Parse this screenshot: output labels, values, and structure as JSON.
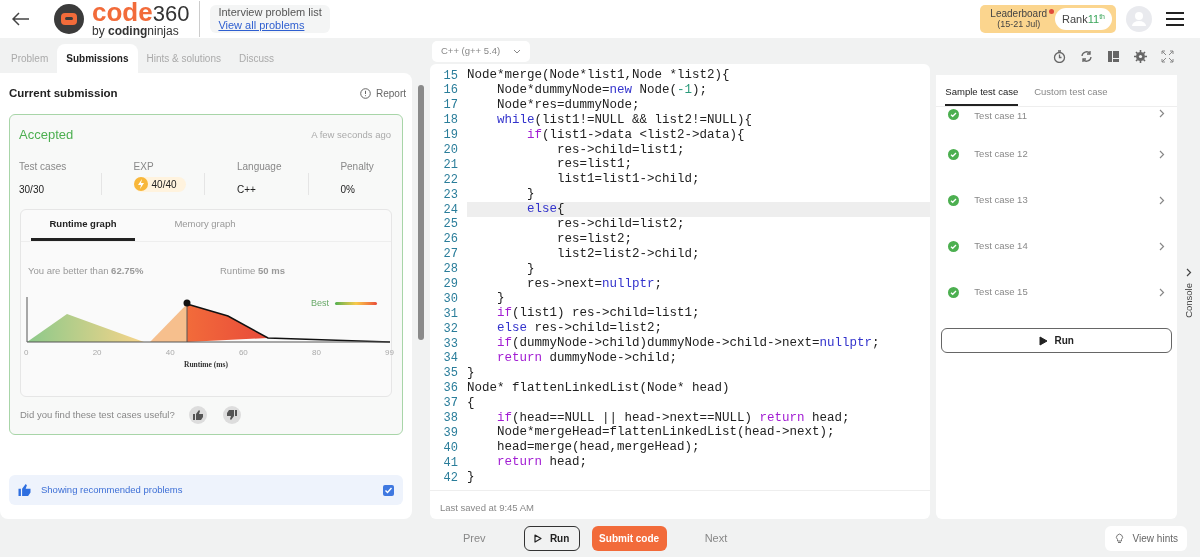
{
  "header": {
    "logo": {
      "word": "code",
      "number": "360",
      "tagline": "by **coding**ninjas"
    },
    "problem_list": {
      "title": "Interview problem list",
      "link": "View all problems"
    },
    "leaderboard": {
      "label": "Leaderboard",
      "dates": "(15-21 Jul)",
      "unread": true,
      "rank_label": "Rank",
      "rank": "11",
      "rank_suffix": "th"
    }
  },
  "tabs": [
    {
      "label": "Problem",
      "selected": false
    },
    {
      "label": "Submissions",
      "selected": true
    },
    {
      "label": "Hints & solutions",
      "selected": false
    },
    {
      "label": "Discuss",
      "selected": false
    }
  ],
  "submission": {
    "title": "Current submission",
    "report": "Report",
    "status": "Accepted",
    "time": "A few seconds ago",
    "stats": [
      {
        "kind": "plain",
        "label": "Test cases",
        "value": "30/30"
      },
      {
        "kind": "exp",
        "label": "EXP",
        "value": "40/40"
      },
      {
        "kind": "plain",
        "label": "Language",
        "value": "C++"
      },
      {
        "kind": "plain",
        "label": "Penalty",
        "value": "0%"
      }
    ],
    "graph_tabs": [
      {
        "label": "Runtime graph",
        "selected": true
      },
      {
        "label": "Memory graph",
        "selected": false
      }
    ],
    "better_than": "You are better than **62.75%**",
    "runtime": "Runtime **50 ms**",
    "graph": {
      "legend": "Best",
      "xticks": [
        "0",
        "20",
        "40",
        "60",
        "80",
        "99"
      ],
      "xlabel": "Runtime (ms)"
    },
    "feedback": "Did you find these test cases useful?"
  },
  "recommended": {
    "label": "Showing recommended problems",
    "checked": true
  },
  "editor": {
    "language": "C++ (g++ 5.4)",
    "saved": "Last saved at 9:45 AM",
    "lines": [
      {
        "number": "15",
        "active": false,
        "tokens": [
          {
            "kind": "plain",
            "text": "Node*merge(Node*list1,Node *list2){"
          }
        ]
      },
      {
        "number": "16",
        "active": false,
        "tokens": [
          {
            "kind": "plain",
            "text": "    Node*dummyNode="
          },
          {
            "kind": "keyword",
            "text": "new"
          },
          {
            "kind": "plain",
            "text": " Node("
          },
          {
            "kind": "number",
            "text": "-1"
          },
          {
            "kind": "plain",
            "text": ");"
          }
        ]
      },
      {
        "number": "17",
        "active": false,
        "tokens": [
          {
            "kind": "plain",
            "text": "    Node*res=dummyNode;"
          }
        ]
      },
      {
        "number": "18",
        "active": false,
        "tokens": [
          {
            "kind": "keyword",
            "text": "    while"
          },
          {
            "kind": "plain",
            "text": "(list1!=NULL && list2!=NULL){"
          }
        ]
      },
      {
        "number": "19",
        "active": false,
        "tokens": [
          {
            "kind": "control",
            "text": "        if"
          },
          {
            "kind": "plain",
            "text": "(list1->data <list2->data){"
          }
        ]
      },
      {
        "number": "20",
        "active": false,
        "tokens": [
          {
            "kind": "plain",
            "text": "            res->child=list1;"
          }
        ]
      },
      {
        "number": "21",
        "active": false,
        "tokens": [
          {
            "kind": "plain",
            "text": "            res=list1;"
          }
        ]
      },
      {
        "number": "22",
        "active": false,
        "tokens": [
          {
            "kind": "plain",
            "text": "            list1=list1->child;"
          }
        ]
      },
      {
        "number": "23",
        "active": false,
        "tokens": [
          {
            "kind": "plain",
            "text": "        }"
          }
        ]
      },
      {
        "number": "24",
        "active": true,
        "tokens": [
          {
            "kind": "keyword",
            "text": "        else"
          },
          {
            "kind": "plain",
            "text": "{"
          }
        ]
      },
      {
        "number": "25",
        "active": false,
        "tokens": [
          {
            "kind": "plain",
            "text": "            res->child=list2;"
          }
        ]
      },
      {
        "number": "26",
        "active": false,
        "tokens": [
          {
            "kind": "plain",
            "text": "            res=list2;"
          }
        ]
      },
      {
        "number": "27",
        "active": false,
        "tokens": [
          {
            "kind": "plain",
            "text": "            list2=list2->child;"
          }
        ]
      },
      {
        "number": "28",
        "active": false,
        "tokens": [
          {
            "kind": "plain",
            "text": "        }"
          }
        ]
      },
      {
        "number": "29",
        "active": false,
        "tokens": [
          {
            "kind": "plain",
            "text": "        res->next="
          },
          {
            "kind": "keyword",
            "text": "nullptr"
          },
          {
            "kind": "plain",
            "text": ";"
          }
        ]
      },
      {
        "number": "30",
        "active": false,
        "tokens": [
          {
            "kind": "plain",
            "text": "    }"
          }
        ]
      },
      {
        "number": "31",
        "active": false,
        "tokens": [
          {
            "kind": "control",
            "text": "    if"
          },
          {
            "kind": "plain",
            "text": "(list1) res->child=list1;"
          }
        ]
      },
      {
        "number": "32",
        "active": false,
        "tokens": [
          {
            "kind": "keyword",
            "text": "    else"
          },
          {
            "kind": "plain",
            "text": " res->child=list2;"
          }
        ]
      },
      {
        "number": "33",
        "active": false,
        "tokens": [
          {
            "kind": "control",
            "text": "    if"
          },
          {
            "kind": "plain",
            "text": "(dummyNode->child)dummyNode->child->next="
          },
          {
            "kind": "keyword",
            "text": "nullptr"
          },
          {
            "kind": "plain",
            "text": ";"
          }
        ]
      },
      {
        "number": "34",
        "active": false,
        "tokens": [
          {
            "kind": "control",
            "text": "    return"
          },
          {
            "kind": "plain",
            "text": " dummyNode->child;"
          }
        ]
      },
      {
        "number": "35",
        "active": false,
        "tokens": [
          {
            "kind": "plain",
            "text": "}"
          }
        ]
      },
      {
        "number": "36",
        "active": false,
        "tokens": [
          {
            "kind": "plain",
            "text": "Node* flattenLinkedList(Node* head)"
          }
        ]
      },
      {
        "number": "37",
        "active": false,
        "tokens": [
          {
            "kind": "plain",
            "text": "{"
          }
        ]
      },
      {
        "number": "38",
        "active": false,
        "tokens": [
          {
            "kind": "control",
            "text": "    if"
          },
          {
            "kind": "plain",
            "text": "(head==NULL || head->next==NULL) "
          },
          {
            "kind": "control",
            "text": "return"
          },
          {
            "kind": "plain",
            "text": " head;"
          }
        ]
      },
      {
        "number": "39",
        "active": false,
        "tokens": [
          {
            "kind": "plain",
            "text": "    Node*mergeHead=flattenLinkedList(head->next);"
          }
        ]
      },
      {
        "number": "40",
        "active": false,
        "tokens": [
          {
            "kind": "plain",
            "text": "    head=merge(head,mergeHead);"
          }
        ]
      },
      {
        "number": "41",
        "active": false,
        "tokens": [
          {
            "kind": "control",
            "text": "    return"
          },
          {
            "kind": "plain",
            "text": " head;"
          }
        ]
      },
      {
        "number": "42",
        "active": false,
        "tokens": [
          {
            "kind": "plain",
            "text": "}"
          }
        ]
      }
    ]
  },
  "test_tabs": [
    {
      "label": "Sample test case",
      "selected": true
    },
    {
      "label": "Custom test case",
      "selected": false
    }
  ],
  "test_cases": [
    {
      "label": "Test case 11",
      "passed": true
    },
    {
      "label": "Test case 12",
      "passed": true
    },
    {
      "label": "Test case 13",
      "passed": true
    },
    {
      "label": "Test case 14",
      "passed": true
    },
    {
      "label": "Test case 15",
      "passed": true
    }
  ],
  "test_run": "Run",
  "console": "Console",
  "footer": {
    "prev": "Prev",
    "run": "Run",
    "submit": "Submit code",
    "next": "Next",
    "hints": "View hints"
  }
}
